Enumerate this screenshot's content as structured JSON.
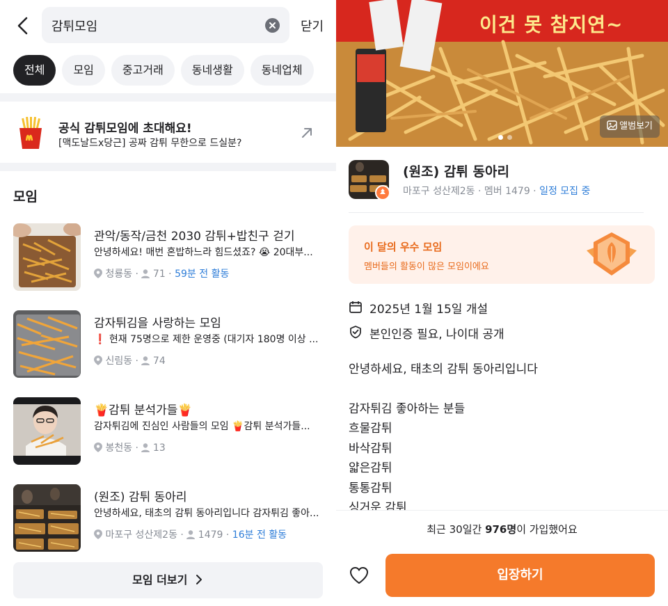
{
  "left": {
    "search": {
      "value": "감튀모임",
      "close_label": "닫기"
    },
    "chips": [
      "전체",
      "모임",
      "중고거래",
      "동네생활",
      "동네업체"
    ],
    "promo": {
      "title": "공식 감튀모임에 초대해요!",
      "subtitle": "[맥도날드x당근] 공짜 감튀 무한으로 드실분?"
    },
    "section_title": "모임",
    "groups": [
      {
        "title": "관악/동작/금천 2030 감튀+밥친구 걷기",
        "desc": "안녕하세요! 매번 혼밥하느라 힘드셨죠? 😭 20대부...",
        "location": "청룡동",
        "members": "71",
        "activity": "59분 전 활동"
      },
      {
        "title": "감자튀김을 사랑하는 모임",
        "desc": "❗ 현재 75명으로 제한 운영중 (대기자 180명 이상 ...",
        "location": "신림동",
        "members": "74",
        "activity": ""
      },
      {
        "title": "🍟감튀 분석가들🍟",
        "desc": "감자튀김에 진심인 사람들의 모임 🍟감튀 분석가들...",
        "location": "봉천동",
        "members": "13",
        "activity": ""
      },
      {
        "title": "(원조) 감튀 동아리",
        "desc": "안녕하세요, 태초의 감튀 동아리입니다 감자튀김 좋아...",
        "location": "마포구 성산제2동",
        "members": "1479",
        "activity": "16분 전 활동"
      }
    ],
    "more_label": "모임 더보기"
  },
  "right": {
    "hero": {
      "caption": "이건 못 참지연~",
      "album_label": "앨범보기"
    },
    "club": {
      "name": "(원조) 감튀 동아리",
      "location": "마포구 성산제2동",
      "members": "멤버 1479",
      "status": "일정 모집 중"
    },
    "best": {
      "title": "이 달의 우수 모임",
      "subtitle": "멤버들의 활동이 많은 모임이에요"
    },
    "info": {
      "founded": "2025년 1월 15일 개설",
      "requirement": "본인인증 필요, 나이대 공개"
    },
    "description": [
      "안녕하세요, 태초의 감튀 동아리입니다",
      "",
      "감자튀김 좋아하는 분들",
      "흐물감튀",
      "바삭감튀",
      "얇은감튀",
      "통통감튀",
      "싱거운 감튀"
    ],
    "join_notice": {
      "prefix": "최근 30일간 ",
      "count": "976명",
      "suffix": "이 가입했어요"
    },
    "enter_label": "입장하기"
  },
  "colors": {
    "accent": "#f57a2b",
    "link_blue": "#2e7dd8",
    "chip_active": "#212124"
  }
}
